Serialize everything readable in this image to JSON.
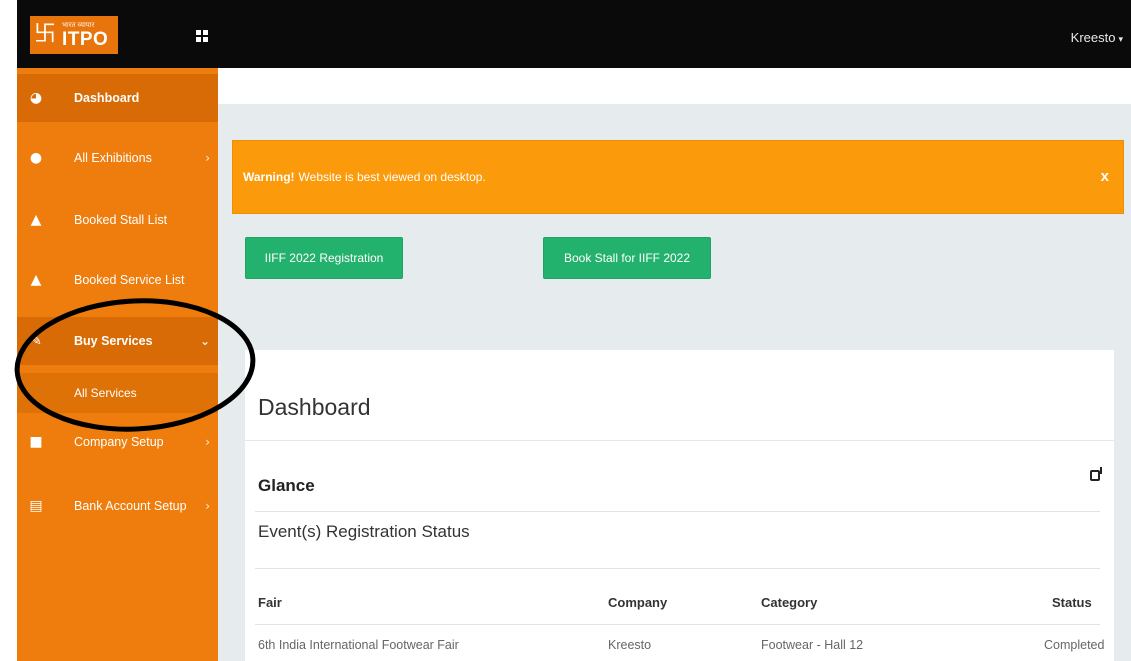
{
  "header": {
    "logo_small": "भारत व्यापार",
    "logo_big": "ITPO",
    "user": "Kreesto"
  },
  "sidebar": {
    "items": [
      {
        "label": "Dashboard",
        "icon": "dashboard-icon"
      },
      {
        "label": "All Exhibitions",
        "icon": "globe-icon"
      },
      {
        "label": "Booked Stall List",
        "icon": "lock-icon"
      },
      {
        "label": "Booked Service List",
        "icon": "lock-icon"
      },
      {
        "label": "Buy Services",
        "icon": "wrench-icon"
      },
      {
        "label": "Company Setup",
        "icon": "briefcase-icon"
      },
      {
        "label": "Bank Account Setup",
        "icon": "card-icon"
      }
    ],
    "sub_items": [
      {
        "label": "All Services"
      }
    ]
  },
  "alert": {
    "strong": "Warning!",
    "message": "Website is best viewed on desktop.",
    "close": "x"
  },
  "buttons": {
    "registration": "IIFF 2022 Registration",
    "book_stall": "Book Stall for IIFF 2022"
  },
  "panel": {
    "title": "Dashboard",
    "glance": "Glance",
    "section": "Event(s) Registration Status",
    "columns": [
      "Fair",
      "Company",
      "Category",
      "Status"
    ],
    "rows": [
      [
        "6th India International Footwear Fair",
        "Kreesto",
        "Footwear - Hall 12",
        "Completed"
      ]
    ]
  },
  "colors": {
    "sidebar": "#ee7d0d",
    "alert": "#fb9a0a",
    "button": "#23b26d",
    "topbar": "#0a0a0a"
  }
}
